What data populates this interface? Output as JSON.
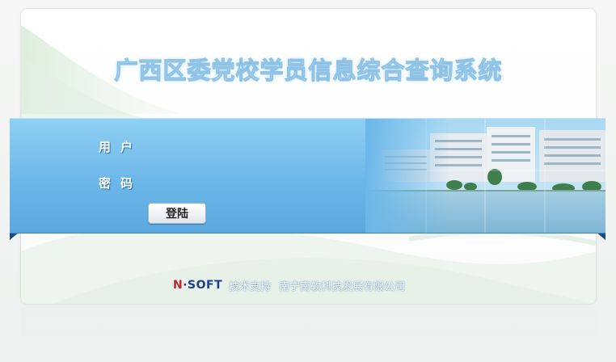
{
  "app": {
    "title": "广西区委党校学员信息综合查询系统"
  },
  "login": {
    "username_label": "用户",
    "password_label": "密码",
    "submit_label": "登陆"
  },
  "footer": {
    "logo_n": "N",
    "logo_rest": "·SOFT",
    "support_label": "技术支持",
    "company": "南宁南软科技发展有限公司"
  },
  "colors": {
    "band_top": "#8fd0f3",
    "band_bottom": "#5aa8df",
    "logo_red": "#c0262d",
    "logo_blue": "#1f3e8c"
  }
}
